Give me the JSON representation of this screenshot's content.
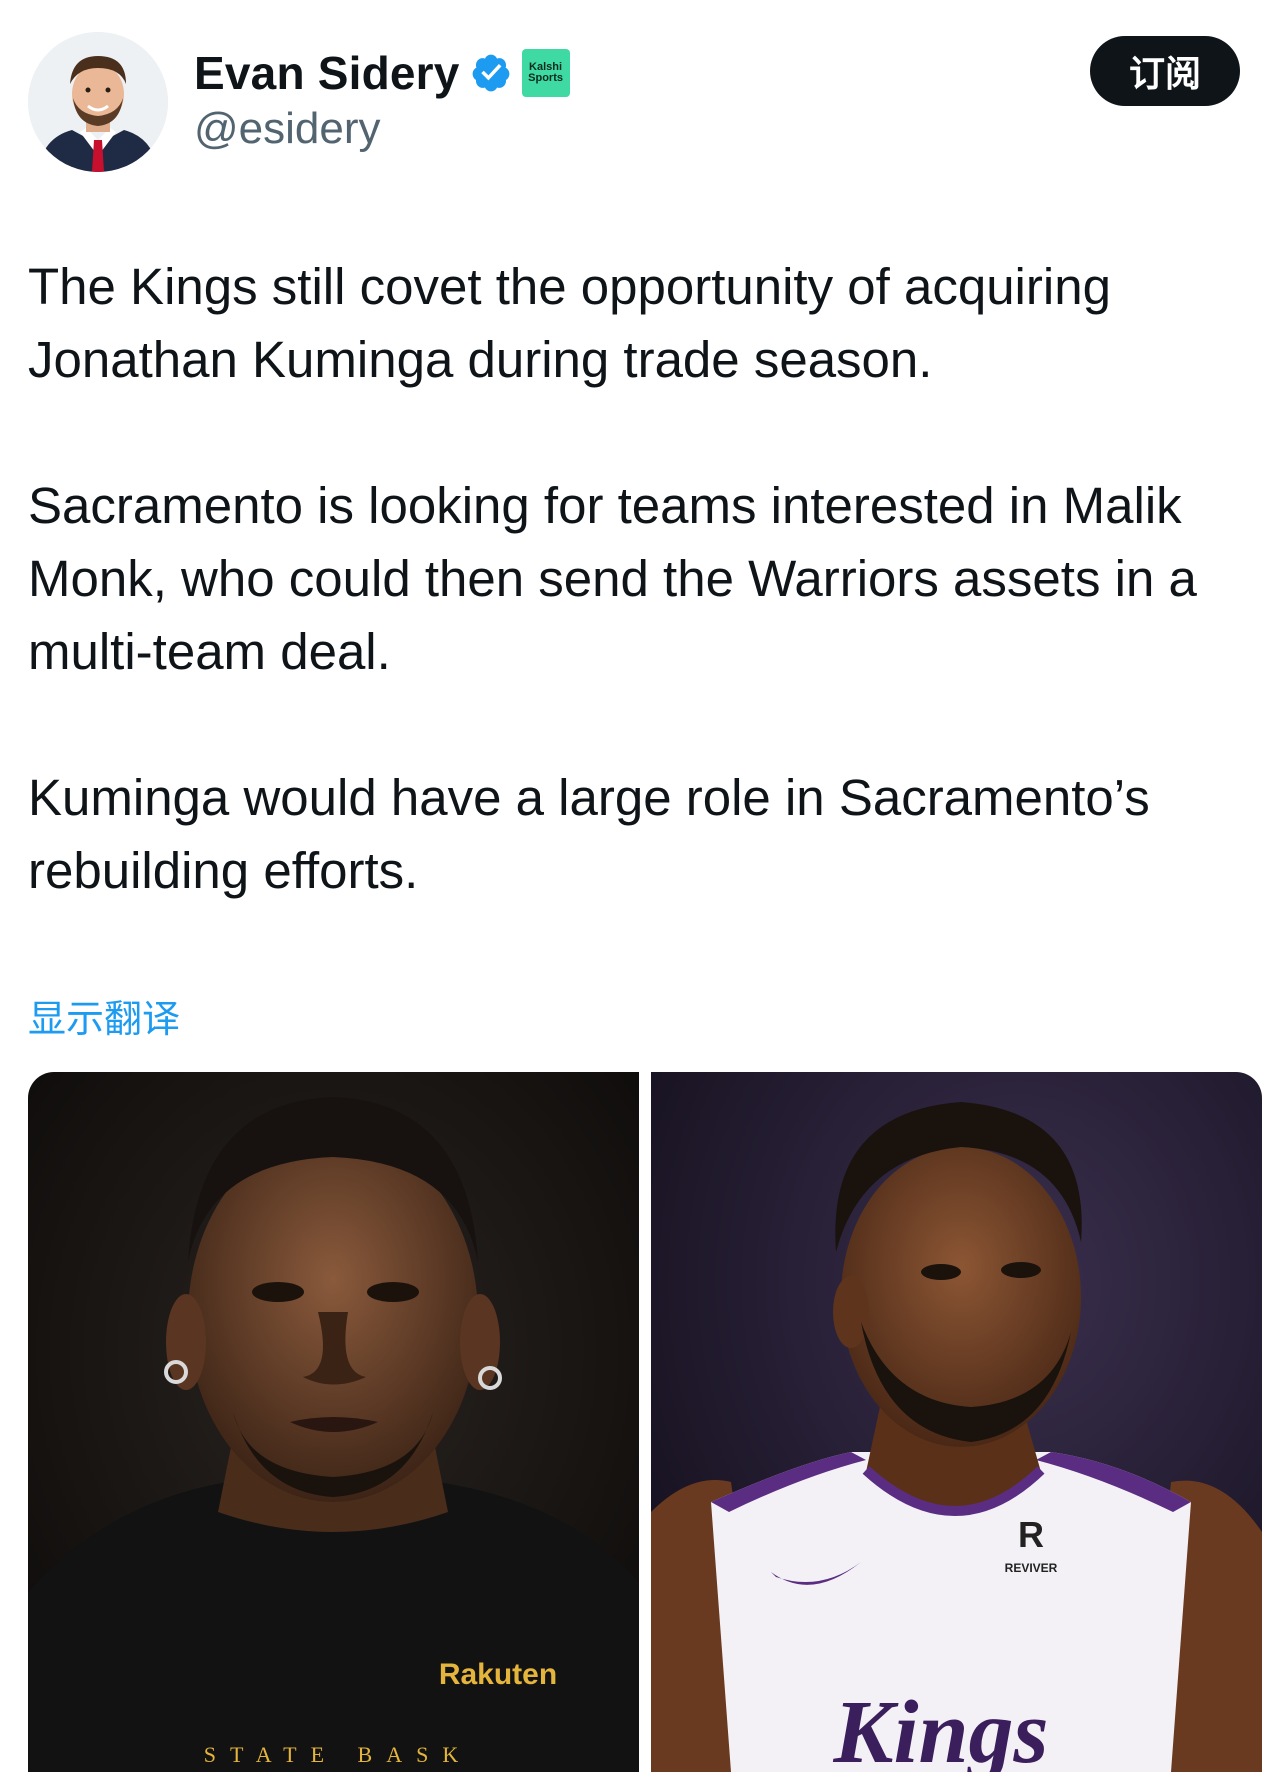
{
  "author": {
    "display_name": "Evan Sidery",
    "handle": "@esidery",
    "verified_icon": "verified-badge-icon",
    "verified_color": "#1d9bf0",
    "affiliate": {
      "line1": "Kalshi",
      "line2": "Sports",
      "color": "#3fd9a3"
    }
  },
  "subscribe_label": "订阅",
  "tweet": {
    "paragraphs": [
      "The Kings still covet the opportunity of acquiring Jonathan Kuminga during trade season.",
      "Sacramento is looking for teams interested in Malik Monk, who could then send the Warriors assets in a multi-team deal.",
      "Kuminga would have a large role in Sacramento’s rebuilding efforts."
    ]
  },
  "translate_label": "显示翻译",
  "media": {
    "left_photo": {
      "jersey_sponsor": "Rakuten",
      "jersey_text": "STATE BASK"
    },
    "right_photo": {
      "sponsor_mark": "R",
      "sponsor_name": "REVIVER",
      "jersey_text": "Kings"
    }
  }
}
